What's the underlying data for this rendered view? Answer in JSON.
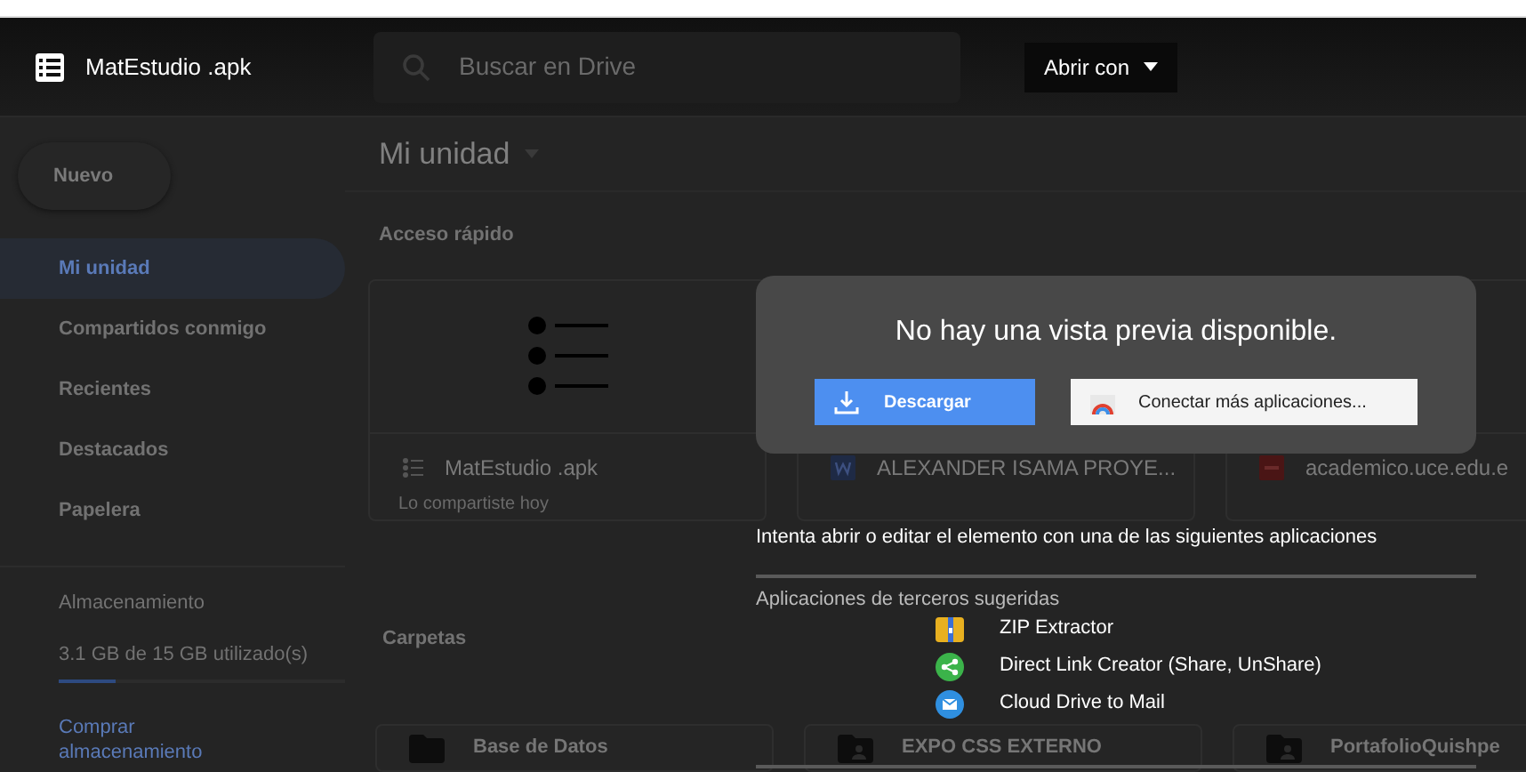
{
  "header": {
    "title": "MatEstudio .apk",
    "search_placeholder": "Buscar en Drive",
    "open_with": "Abrir con"
  },
  "sidebar": {
    "new_button": "Nuevo",
    "items": [
      {
        "label": "Mi unidad",
        "selected": true
      },
      {
        "label": "Compartidos conmigo",
        "selected": false
      },
      {
        "label": "Recientes",
        "selected": false
      },
      {
        "label": "Destacados",
        "selected": false
      },
      {
        "label": "Papelera",
        "selected": false
      }
    ],
    "storage": {
      "title": "Almacenamiento",
      "usage": "3.1 GB de 15 GB utilizado(s)",
      "level": 0.2,
      "buy_link": "Comprar almacenamiento"
    }
  },
  "main": {
    "title": "Mi unidad",
    "quick_access": "Acceso rápido",
    "files": [
      {
        "name": "MatEstudio .apk",
        "kind": "list",
        "subtitle": "Lo compartiste hoy"
      },
      {
        "name": "ALEXANDER ISAMA PROYE...",
        "kind": "word"
      },
      {
        "name": "academico.uce.edu.e",
        "kind": "pdf"
      }
    ],
    "folders_title": "Carpetas",
    "folders": [
      {
        "name": "Base de Datos",
        "kind": "folder"
      },
      {
        "name": "EXPO CSS EXTERNO",
        "kind": "shared"
      },
      {
        "name": "PortafolioQuishpe",
        "kind": "shared"
      }
    ]
  },
  "preview": {
    "message": "No hay una vista previa disponible.",
    "download": "Descargar",
    "connect": "Conectar más aplicaciones...",
    "hint": "Intenta abrir o editar el elemento con una de las siguientes aplicaciones",
    "suggested_title": "Aplicaciones de terceros sugeridas",
    "apps": [
      {
        "name": "ZIP Extractor",
        "kind": "zip"
      },
      {
        "name": "Direct Link Creator (Share, UnShare)",
        "kind": "share"
      },
      {
        "name": "Cloud Drive to Mail",
        "kind": "mail"
      }
    ]
  }
}
